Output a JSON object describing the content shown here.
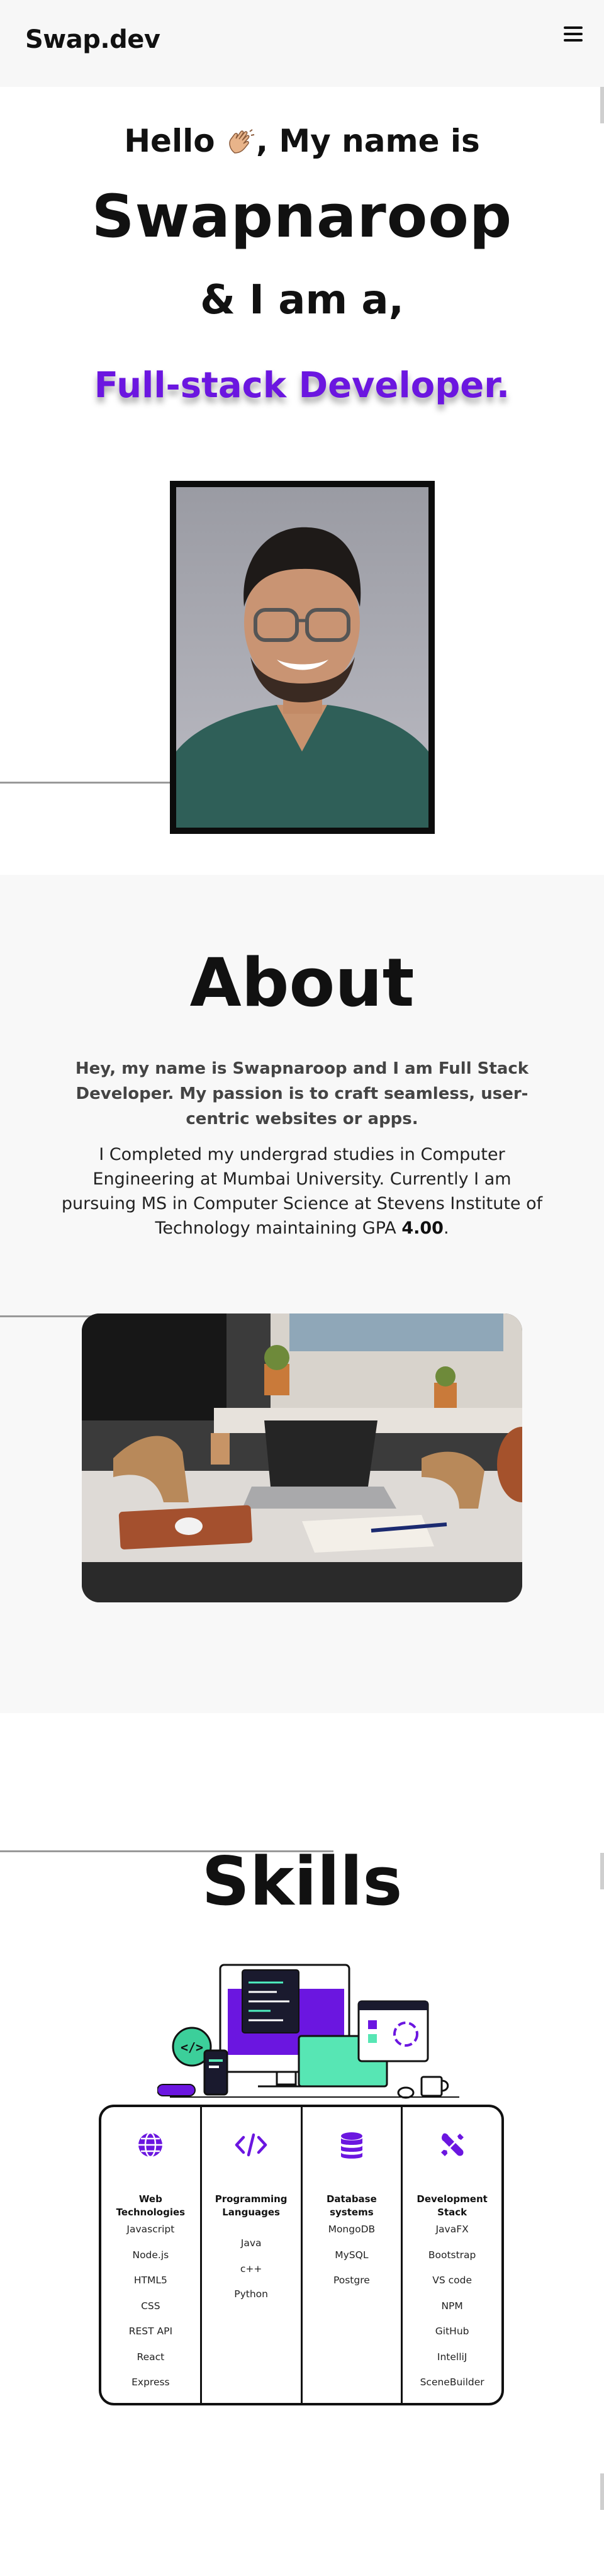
{
  "header": {
    "brand": "Swap.dev",
    "menu_icon": "hamburger-menu-icon"
  },
  "hero": {
    "greeting_prefix": "Hello",
    "greeting_suffix": ", My name is",
    "name": "Swapnaroop",
    "intro": "& I am a,",
    "role": "Full-stack Developer.",
    "accent_color": "#6b16e0"
  },
  "about": {
    "title": "About",
    "paragraph1": "Hey, my name is Swapnaroop and I am Full Stack Developer. My passion is to craft seamless, user-centric websites or apps.",
    "paragraph2_text": "I Completed my undergrad studies in Computer Engineering at Mumbai University. Currently I am pursuing MS in Computer Science at Stevens Institute of Technology maintaining GPA ",
    "gpa": "4.00",
    "paragraph2_end": "."
  },
  "skills": {
    "title": "Skills",
    "columns": [
      {
        "icon": "globe-icon",
        "heading": "Web Technologies",
        "items": [
          "Javascript",
          "Node.js",
          "HTML5",
          "CSS",
          "REST API",
          "React",
          "Express"
        ]
      },
      {
        "icon": "code-icon",
        "heading": "Programming Languages",
        "items": [
          "Java",
          "c++",
          "Python"
        ]
      },
      {
        "icon": "database-icon",
        "heading": "Database systems",
        "items": [
          "MongoDB",
          "MySQL",
          "Postgre"
        ]
      },
      {
        "icon": "tools-icon",
        "heading": "Development Stack",
        "items": [
          "JavaFX",
          "Bootstrap",
          "VS code",
          "NPM",
          "GitHub",
          "IntelliJ",
          "SceneBuilder"
        ]
      }
    ]
  }
}
